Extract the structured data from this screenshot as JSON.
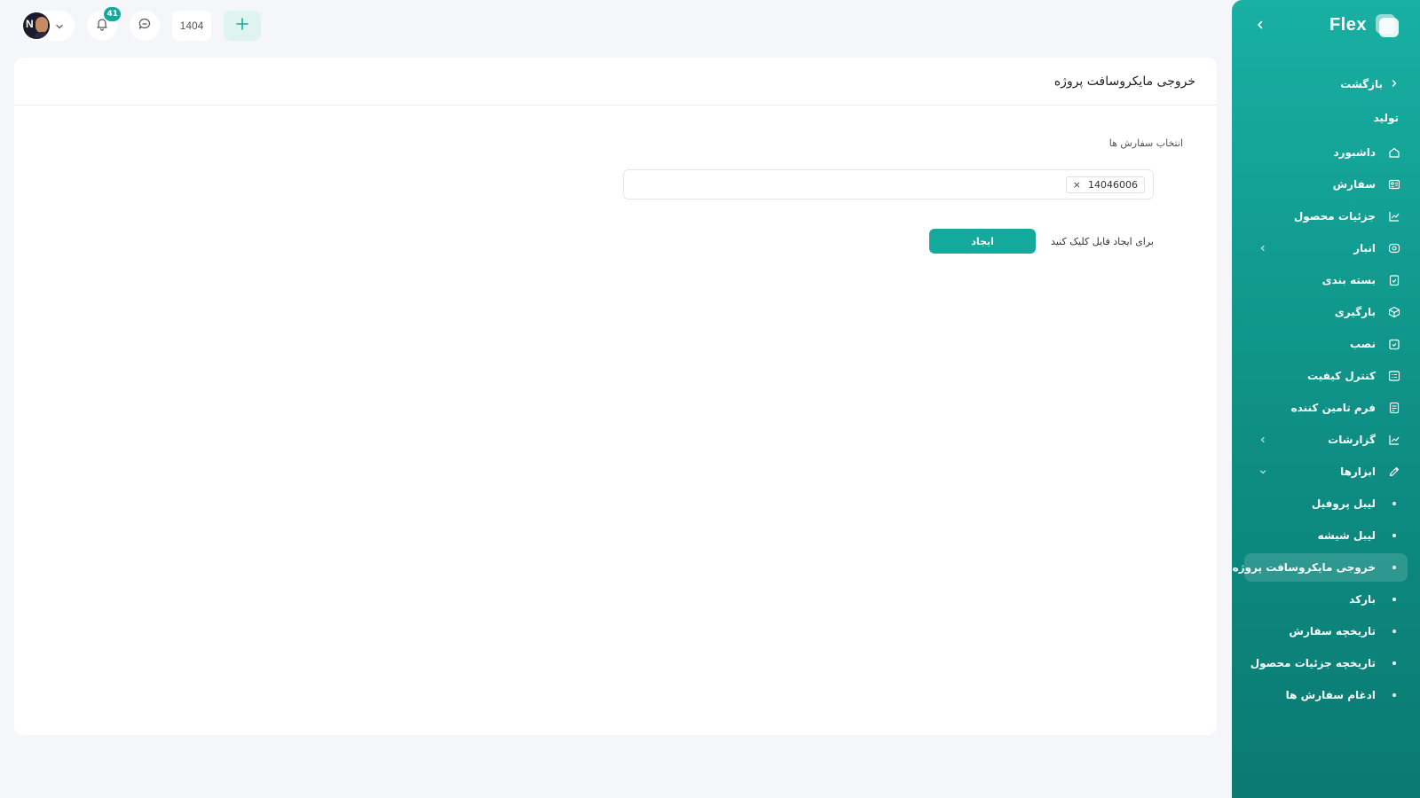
{
  "app": {
    "logo_text": "Flex"
  },
  "topbar": {
    "notification_count": "41",
    "year": "1404",
    "avatar_initial": "N"
  },
  "sidebar": {
    "back_label": "بازگشت",
    "section_label": "تولید",
    "items": [
      {
        "label": "داشبورد",
        "icon": "home-icon"
      },
      {
        "label": "سفارش",
        "icon": "id-card-icon"
      },
      {
        "label": "جزئیات محصول",
        "icon": "chart-line-icon"
      },
      {
        "label": "انبار",
        "icon": "warehouse-icon",
        "expandable": true
      },
      {
        "label": "بسته بندی",
        "icon": "clipboard-check-icon"
      },
      {
        "label": "بارگیری",
        "icon": "box-icon"
      },
      {
        "label": "نصب",
        "icon": "calendar-check-icon"
      },
      {
        "label": "کنترل کیفیت",
        "icon": "list-icon"
      },
      {
        "label": "فرم تامین کننده",
        "icon": "document-icon"
      },
      {
        "label": "گزارشات",
        "icon": "chart-line-icon",
        "expandable": true
      },
      {
        "label": "ابزارها",
        "icon": "pencil-icon",
        "expanded": true
      },
      {
        "label": "لیبل پروفیل",
        "sub": true
      },
      {
        "label": "لیبل شیشه",
        "sub": true
      },
      {
        "label": "خروجی مایکروسافت پروژه",
        "sub": true,
        "active": true
      },
      {
        "label": "بارکد",
        "sub": true
      },
      {
        "label": "تاریخچه سفارش",
        "sub": true
      },
      {
        "label": "تاریخچه جزئیات محصول",
        "sub": true
      },
      {
        "label": "ادغام سفارش ها",
        "sub": true
      }
    ]
  },
  "main": {
    "title": "خروجی مایکروسافت پروژه",
    "field_label": "انتخاب سفارش ها",
    "selected_order": "14046006",
    "chip_remove": "×",
    "hint": "برای ایجاد فایل کلیک کنید",
    "create_label": "ایجاد"
  },
  "colors": {
    "accent": "#14a99d",
    "sidebar_top": "#18b0a3",
    "sidebar_bottom": "#0a7a72",
    "page_bg": "#f4f6f9"
  }
}
